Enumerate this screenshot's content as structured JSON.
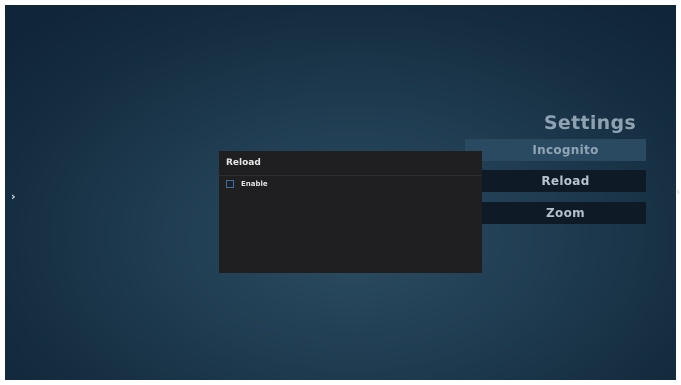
{
  "nav": {
    "left_arrow": "›",
    "right_arrow": "‹"
  },
  "settings": {
    "title": "Settings",
    "items": [
      {
        "label": "Incognito"
      },
      {
        "label": "Reload"
      },
      {
        "label": "Zoom"
      }
    ]
  },
  "dialog": {
    "title": "Reload",
    "option_label": "Enable",
    "option_checked": false
  },
  "colors": {
    "background": "#1d3a4f",
    "dialog_bg": "#1f1f21",
    "checkbox_border": "#3b6fa0",
    "menu_highlight": "#2a4a62"
  },
  "icons": {
    "left": "chevron-right-icon",
    "right": "chevron-left-icon"
  }
}
